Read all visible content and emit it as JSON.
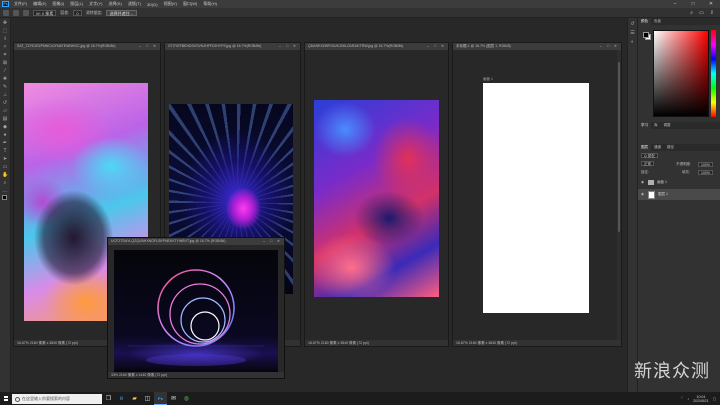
{
  "app": {
    "logo": "Ps",
    "menu": [
      "文件(F)",
      "编辑(E)",
      "图像(I)",
      "图层(L)",
      "文字(Y)",
      "选择(S)",
      "滤镜(T)",
      "3D(D)",
      "视图(V)",
      "窗口(W)",
      "帮助(H)"
    ],
    "window_controls": [
      "–",
      "□",
      "✕"
    ]
  },
  "options_bar": {
    "width_field": "W: 0 像素",
    "tolerance_label": "容差:",
    "tolerance_value": "0",
    "aa_label": "消除锯齿",
    "sample_btn": "选择并遮住..."
  },
  "documents": [
    {
      "tab": "SAT_TZYEJEZPMNC4JYNATEWNHGC.jpg @ 16.7%(RGB/8#)",
      "status": "16.67%   2160 像素 x 3840 像素 (72 ppi)"
    },
    {
      "tab": "GTZYEFBEHDSXSVNJHFFDJHYFS.jpg @ 16.7%(RGB/8#)",
      "status": "16.67%   2160 像素 x 3840 像素 (72 ppi)"
    },
    {
      "tab": "QDAHEXZWFGIUKJXKLOUEUKTRW.jpg @ 16.7%(RGB/8#)",
      "status": "16.67%   2160 像素 x 3840 像素 (72 ppi)"
    },
    {
      "tab": "未标题-1 @ 16.7% (图层 1, RGB/8)",
      "status": "16.67%   2160 像素 x 3840 像素 (72 ppi)",
      "artboard_label": "画板 1"
    },
    {
      "tab": "UCFZTDAYLQZQUBHXNOFLSKPNEKKTYWBVT.jpg @ 16.7% (RGB/8#)",
      "status": "33%   2160 像素 x 1440 像素 (72 ppi)"
    }
  ],
  "right_panel": {
    "color_tabs": [
      "颜色",
      "色板"
    ],
    "props_tabs": [
      "学习",
      "库",
      "调整"
    ],
    "layers_tabs": [
      "图层",
      "通道",
      "路径"
    ],
    "kind_label": "Q 类型",
    "blend_mode": "正常",
    "opacity_label": "不透明度:",
    "opacity_value": "100%",
    "lock_label": "锁定:",
    "fill_label": "填充:",
    "fill_value": "100%",
    "layers": [
      {
        "name": "画板 1",
        "type": "artboard"
      },
      {
        "name": "图层 1",
        "type": "layer",
        "selected": true
      }
    ]
  },
  "taskbar": {
    "search_placeholder": "在这里输入你要搜索的内容",
    "time": "10:04",
    "date": "2020/8/21",
    "apps": [
      "task-view",
      "edge",
      "explorer",
      "store",
      "photoshop",
      "mail",
      "chrome"
    ]
  },
  "watermark": {
    "text": "新浪众测"
  }
}
